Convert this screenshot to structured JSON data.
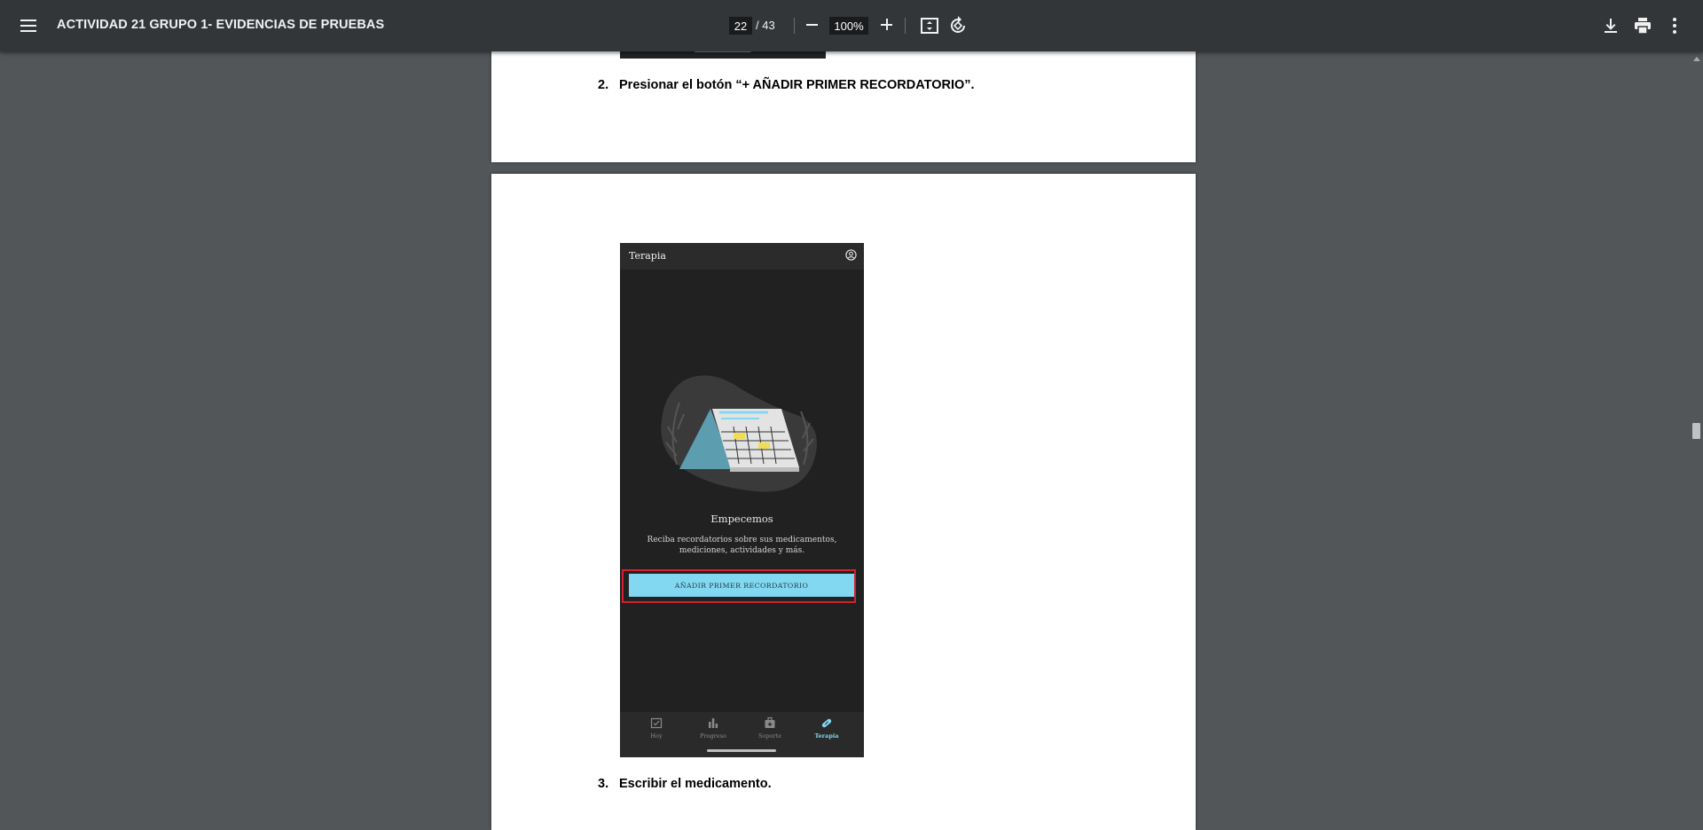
{
  "toolbar": {
    "title": "ACTIVIDAD 21 GRUPO 1- EVIDENCIAS DE PRUEBAS",
    "page_current": "22",
    "page_total": "/ 43",
    "zoom": "100%"
  },
  "page1": {
    "step_number": "2.",
    "step_text": "Presionar el botón “+ AÑADIR PRIMER RECORDATORIO”."
  },
  "phone": {
    "appbar_title": "Terapia",
    "empty_title": "Empecemos",
    "empty_desc": "Reciba recordatorios sobre sus medicamentos, mediciones, actividades y más.",
    "add_button": "AÑADIR PRIMER RECORDATORIO",
    "nav": [
      {
        "label": "Hoy",
        "icon": "calendar-check-icon",
        "active": false
      },
      {
        "label": "Progreso",
        "icon": "bar-chart-icon",
        "active": false
      },
      {
        "label": "Soporte",
        "icon": "medical-bag-icon",
        "active": false
      },
      {
        "label": "Terapia",
        "icon": "pill-icon",
        "active": true
      }
    ],
    "accent_color": "#81d8f0",
    "highlight_color": "#d42030"
  },
  "page2": {
    "step_number": "3.",
    "step_text": "Escribir el medicamento."
  }
}
